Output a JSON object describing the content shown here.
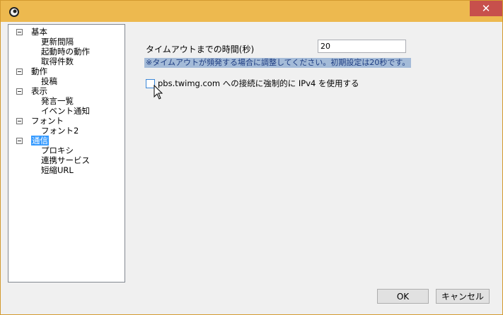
{
  "window": {
    "close_glyph": "✕"
  },
  "tree": {
    "groups": [
      {
        "label": "基本",
        "children": [
          "更新間隔",
          "起動時の動作",
          "取得件数"
        ]
      },
      {
        "label": "動作",
        "children": [
          "投稿"
        ]
      },
      {
        "label": "表示",
        "children": [
          "発言一覧",
          "イベント通知"
        ]
      },
      {
        "label": "フォント",
        "children": [
          "フォント2"
        ]
      },
      {
        "label": "通信",
        "selected": true,
        "children": [
          "プロキシ",
          "連携サービス",
          "短縮URL"
        ]
      }
    ]
  },
  "settings": {
    "timeout_label": "タイムアウトまでの時間(秒)",
    "timeout_value": "20",
    "notice": "※タイムアウトが頻発する場合に調整してください。初期設定は20秒です。",
    "ipv4_label": "pbs.twimg.com への接続に強制的に IPv4 を使用する",
    "ipv4_checked": false
  },
  "buttons": {
    "ok": "OK",
    "cancel": "キャンセル"
  },
  "colors": {
    "titlebar": "#edb94f",
    "close": "#c7504c",
    "selection": "#3399ff",
    "notice_bg": "#a4bbd8"
  }
}
